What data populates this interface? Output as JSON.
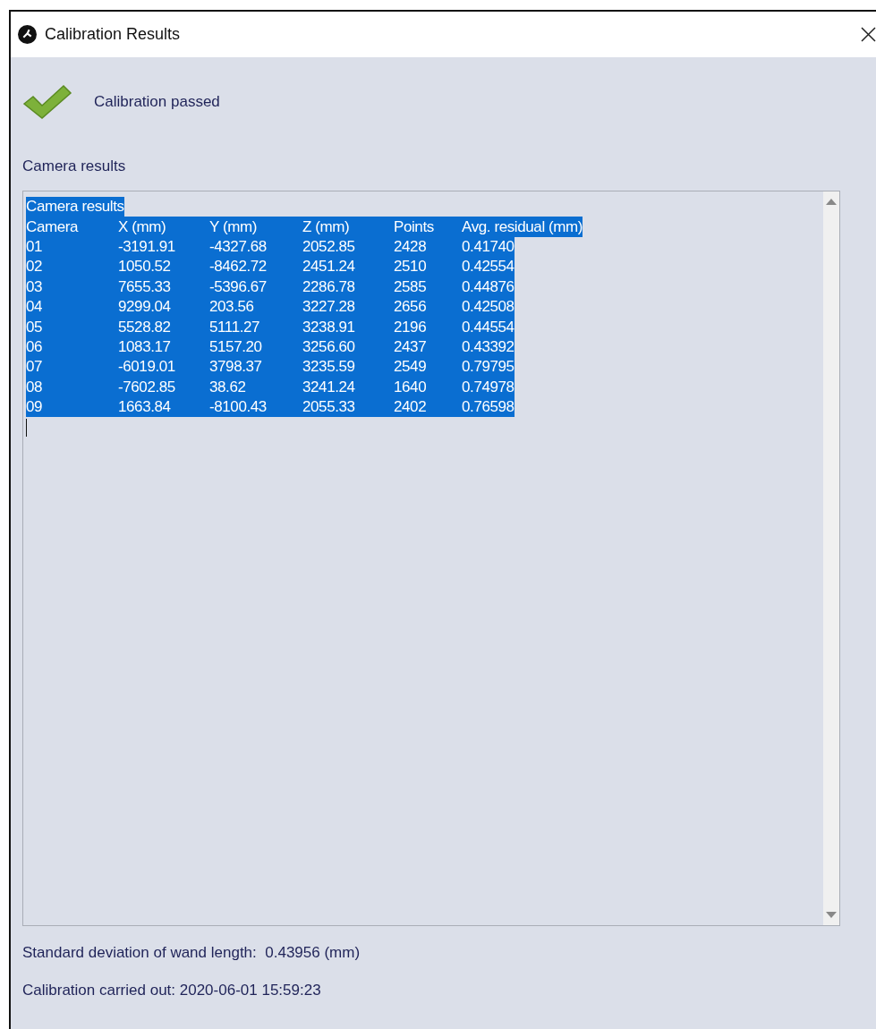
{
  "window": {
    "title": "Calibration Results"
  },
  "status": {
    "kind": "passed",
    "message": "Calibration passed"
  },
  "results_label": "Camera results",
  "results_box": {
    "title": {
      "text": "Camera results",
      "selected": true
    },
    "header": {
      "cells": [
        "Camera",
        "X (mm)",
        "Y (mm)",
        "Z (mm)",
        "Points",
        "Avg. residual (mm)"
      ],
      "selected": true
    },
    "rows": [
      {
        "cells": [
          "01",
          "-3191.91",
          "-4327.68",
          "2052.85",
          "2428",
          "0.41740"
        ],
        "selected": true
      },
      {
        "cells": [
          "02",
          "1050.52",
          "-8462.72",
          "2451.24",
          "2510",
          "0.42554"
        ],
        "selected": true
      },
      {
        "cells": [
          "03",
          "7655.33",
          "-5396.67",
          "2286.78",
          "2585",
          "0.44876"
        ],
        "selected": true
      },
      {
        "cells": [
          "04",
          "9299.04",
          "203.56",
          "3227.28",
          "2656",
          "0.42508"
        ],
        "selected": true
      },
      {
        "cells": [
          "05",
          "5528.82",
          "5111.27",
          "3238.91",
          "2196",
          "0.44554"
        ],
        "selected": true
      },
      {
        "cells": [
          "06",
          "1083.17",
          "5157.20",
          "3256.60",
          "2437",
          "0.43392"
        ],
        "selected": true
      },
      {
        "cells": [
          "07",
          "-6019.01",
          "3798.37",
          "3235.59",
          "2549",
          "0.79795"
        ],
        "selected": true
      },
      {
        "cells": [
          "08",
          "-7602.85",
          "38.62",
          "3241.24",
          "1640",
          "0.74978"
        ],
        "selected": true
      },
      {
        "cells": [
          "09",
          "1663.84",
          "-8100.43",
          "2055.33",
          "2402",
          "0.76598"
        ],
        "selected": true
      }
    ]
  },
  "footer": [
    "Standard deviation of wand length:  0.43956 (mm)",
    "Calibration carried out: 2020-06-01 15:59:23"
  ]
}
